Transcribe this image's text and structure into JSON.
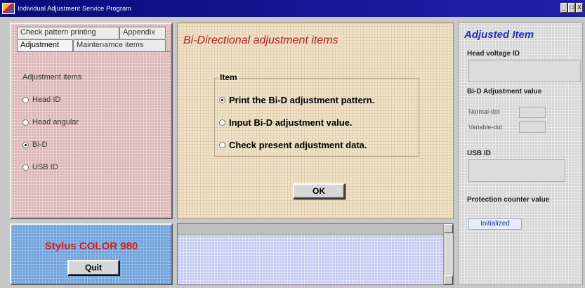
{
  "window": {
    "title": "Individual Adjustment Service Program",
    "buttons": [
      "_",
      "□",
      "X"
    ]
  },
  "tabs": {
    "back_row": [
      "Check pattern printing",
      "Appendix"
    ],
    "front_row": [
      "Adjustment",
      "Maintenamce items"
    ],
    "active": "Adjustment"
  },
  "adjustment": {
    "group_label": "Adjustment items",
    "items": [
      {
        "label": "Head ID",
        "selected": false
      },
      {
        "label": "Head angular",
        "selected": false
      },
      {
        "label": "Bi-D",
        "selected": true
      },
      {
        "label": "USB ID",
        "selected": false
      }
    ]
  },
  "model": {
    "name": "Stylus COLOR 980",
    "quit_label": "Quit"
  },
  "bid": {
    "heading": "Bi-Directional adjustment items",
    "group_label": "Item",
    "options": [
      {
        "label": "Print the Bi-D adjustment pattern.",
        "selected": true
      },
      {
        "label": "Input Bi-D adjustment value.",
        "selected": false
      },
      {
        "label": "Check present adjustment data.",
        "selected": false
      }
    ],
    "ok_label": "OK"
  },
  "adjusted": {
    "title": "Adjusted Item",
    "head_voltage_label": "Head voltage ID",
    "bid_label": "Bi-D Adjustment value",
    "normal_dot_label": "Normal-dot",
    "variable_dot_label": "Variable-dot",
    "usb_label": "USB ID",
    "protection_label": "Protection counter value",
    "protection_value": "Initialized"
  }
}
